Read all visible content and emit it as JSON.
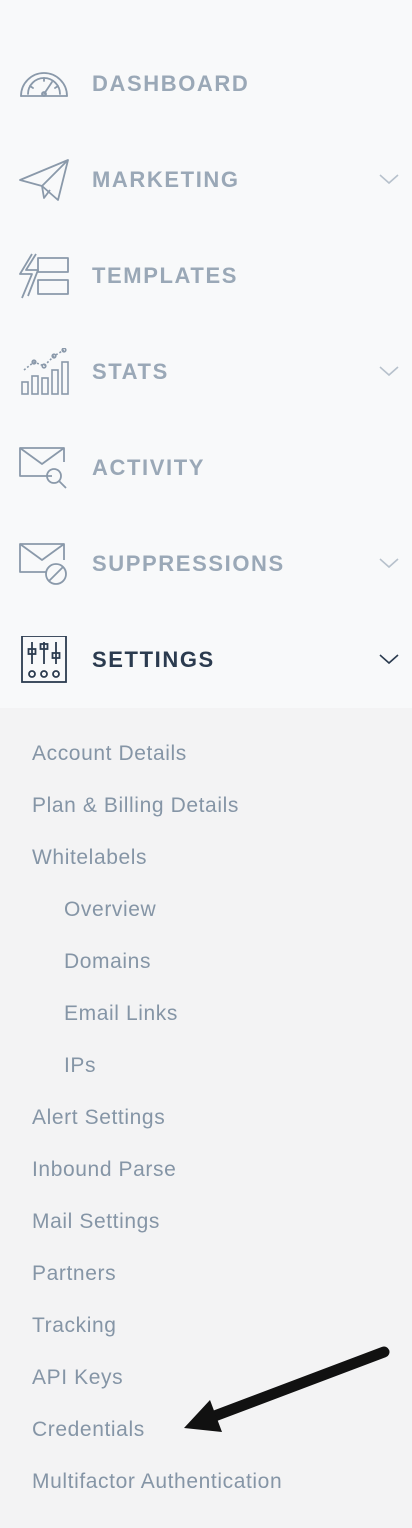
{
  "nav": {
    "items": [
      {
        "label": "DASHBOARD",
        "icon": "dashboard-gauge-icon"
      },
      {
        "label": "MARKETING",
        "icon": "paper-plane-icon",
        "expandable": true
      },
      {
        "label": "TEMPLATES",
        "icon": "templates-icon"
      },
      {
        "label": "STATS",
        "icon": "stats-chart-icon",
        "expandable": true
      },
      {
        "label": "ACTIVITY",
        "icon": "envelope-search-icon"
      },
      {
        "label": "SUPPRESSIONS",
        "icon": "envelope-blocked-icon",
        "expandable": true
      },
      {
        "label": "SETTINGS",
        "icon": "sliders-icon",
        "expandable": true,
        "active": true
      }
    ]
  },
  "settings_submenu": {
    "items": [
      "Account Details",
      "Plan & Billing Details",
      "Whitelabels",
      "Overview",
      "Domains",
      "Email Links",
      "IPs",
      "Alert Settings",
      "Inbound Parse",
      "Mail Settings",
      "Partners",
      "Tracking",
      "API Keys",
      "Credentials",
      "Multifactor Authentication"
    ]
  },
  "colors": {
    "inactive_text": "#9aa8b7",
    "active_text": "#2b3b4f",
    "submenu_text": "#8595a6",
    "nav_bg": "#f8f9fa",
    "submenu_bg": "#f3f3f4",
    "annotation_arrow": "#111111"
  }
}
